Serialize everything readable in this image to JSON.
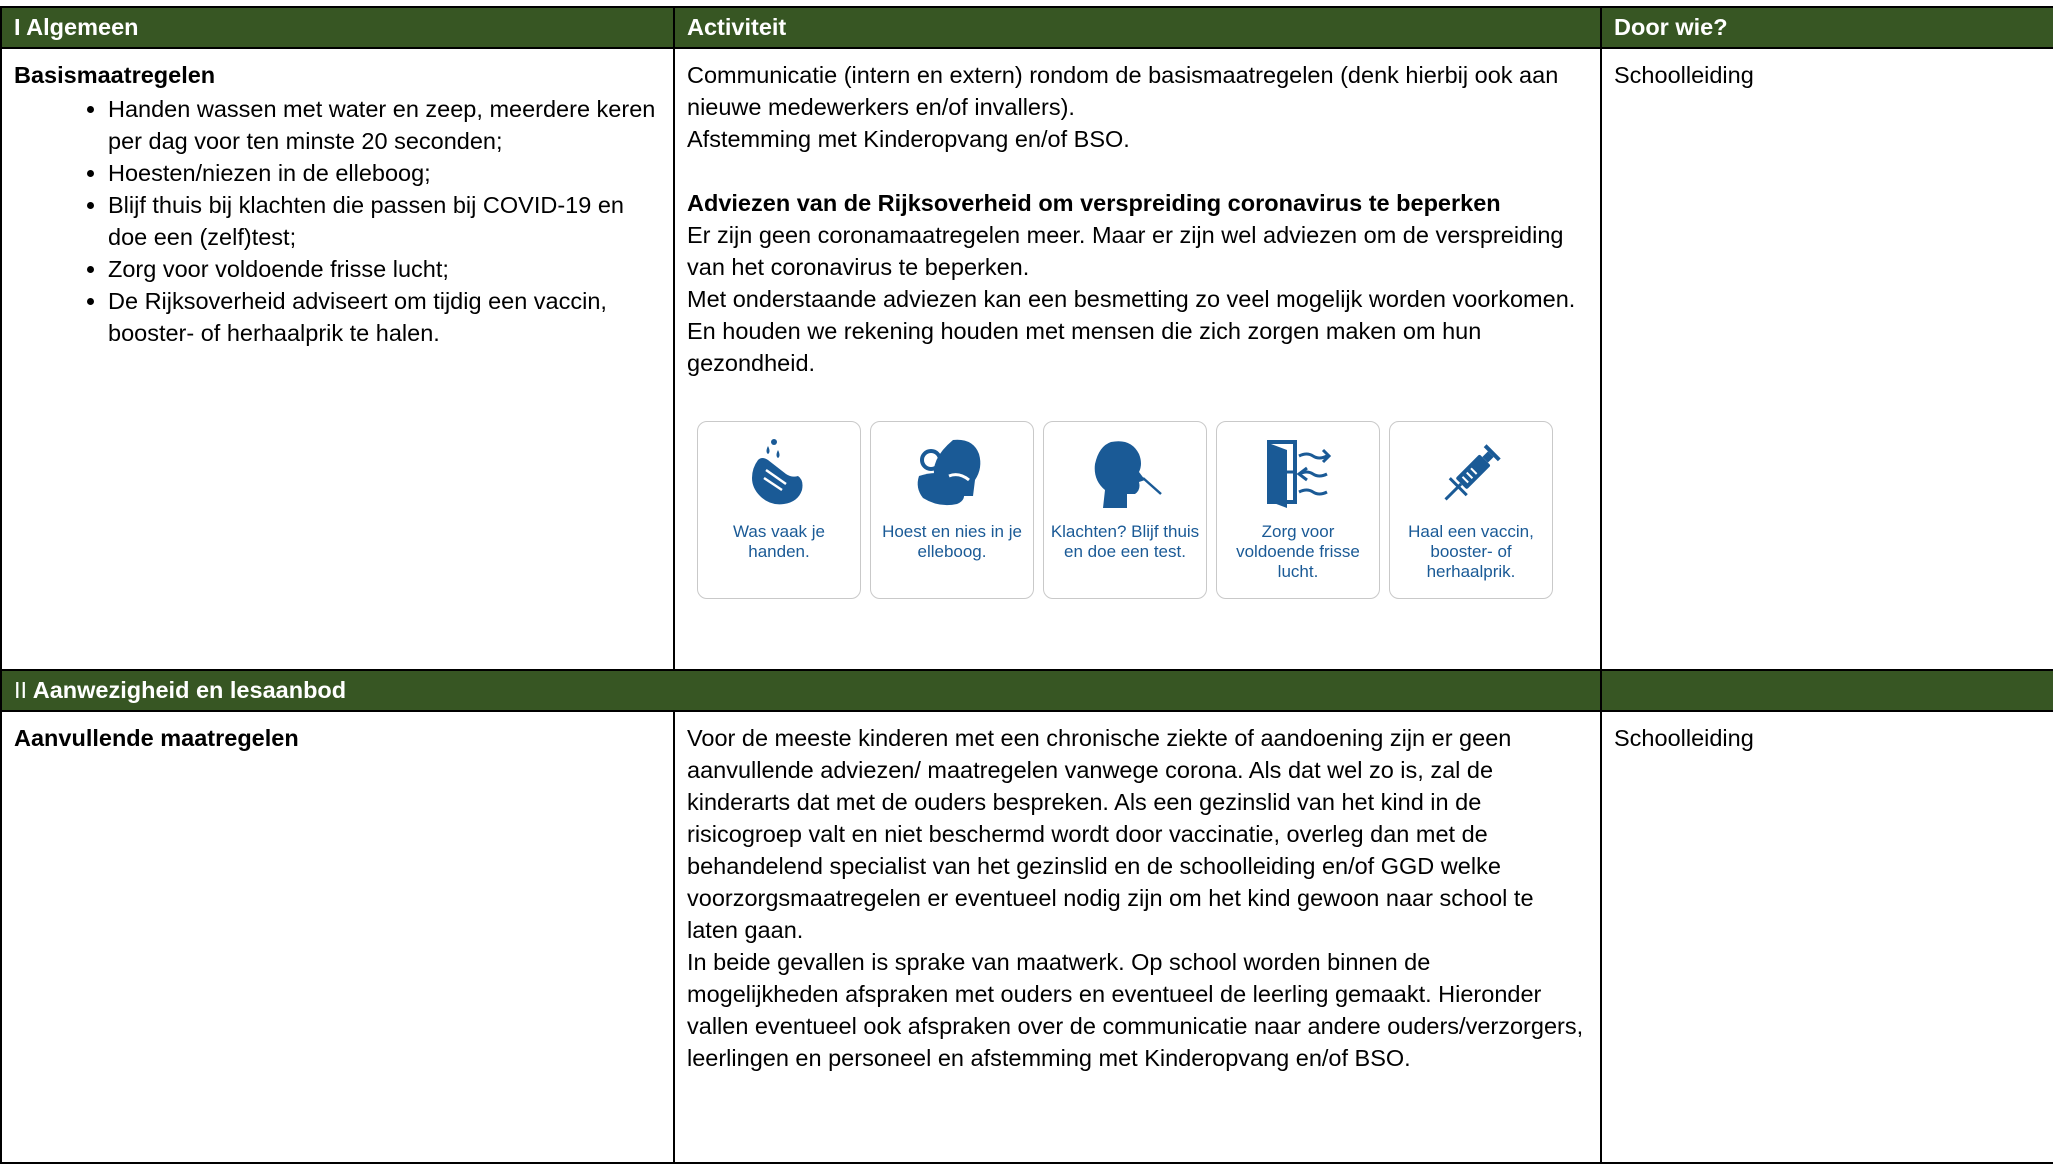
{
  "table": {
    "header1": {
      "col1": "I Algemeen",
      "col2": "Activiteit",
      "col3": "Door wie?"
    },
    "row1": {
      "title": "Basismaatregelen",
      "bullets": [
        "Handen wassen met water en zeep, meerdere keren per dag voor ten minste 20 seconden;",
        "Hoesten/niezen in de elleboog;",
        "Blijf thuis bij klachten die passen bij COVID-19 en doe een (zelf)test;",
        "Zorg voor voldoende frisse lucht;",
        "De Rijksoverheid adviseert om tijdig een vaccin, booster- of herhaalprik te halen."
      ],
      "activity_p1": "Communicatie (intern en extern) rondom de basismaatregelen (denk hierbij ook aan nieuwe medewerkers en/of invallers).",
      "activity_p2": "Afstemming met Kinderopvang en/of BSO.",
      "advice_heading": "Adviezen van de Rijksoverheid om verspreiding coronavirus te beperken",
      "advice_p1": "Er zijn geen coronamaatregelen meer. Maar er zijn wel adviezen om de verspreiding van het coronavirus te beperken.",
      "advice_p2": "Met onderstaande adviezen kan een besmetting zo veel mogelijk worden voorkomen. En houden we rekening houden met mensen die zich zorgen maken om hun gezondheid.",
      "icons": [
        {
          "icon": "hand-wash-icon",
          "caption": "Was vaak je handen."
        },
        {
          "icon": "cough-elbow-icon",
          "caption": "Hoest en nies in je elleboog."
        },
        {
          "icon": "symptoms-test-icon",
          "caption": "Klachten? Blijf thuis en doe een test."
        },
        {
          "icon": "fresh-air-icon",
          "caption": "Zorg voor voldoende frisse lucht."
        },
        {
          "icon": "vaccine-icon",
          "caption": "Haal een vaccin, booster- of herhaalprik."
        }
      ],
      "who": "Schoolleiding"
    },
    "header2": {
      "prefix": "II",
      "label": "Aanwezigheid en lesaanbod"
    },
    "row2": {
      "title": "Aanvullende maatregelen",
      "p1": "Voor de meeste kinderen met een chronische ziekte of aandoening zijn er geen aanvullende adviezen/ maatregelen vanwege corona. Als dat wel zo is, zal de kinderarts dat met de ouders bespreken. Als een gezinslid van het kind in de risicogroep valt en niet beschermd wordt door vaccinatie, overleg dan met de behandelend specialist van het gezinslid en de schoolleiding en/of GGD welke voorzorgsmaatregelen er eventueel nodig zijn om het kind gewoon naar school te laten gaan.",
      "p2": "In beide gevallen is sprake van maatwerk. Op school worden binnen de mogelijkheden afspraken met ouders en eventueel de leerling gemaakt. Hieronder vallen eventueel ook afspraken over de communicatie naar andere ouders/verzorgers, leerlingen en personeel en afstemming met Kinderopvang en/of BSO.",
      "who": "Schoolleiding"
    }
  },
  "colors": {
    "header_bg": "#375623",
    "icon_blue": "#1a5a96"
  }
}
